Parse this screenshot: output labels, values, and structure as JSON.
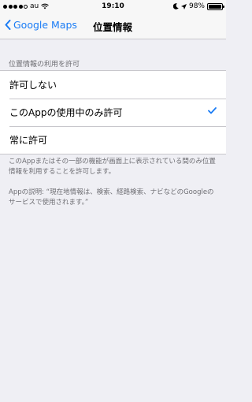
{
  "status_bar": {
    "carrier": "au",
    "time": "19:10",
    "battery_percent": "98%",
    "battery_level": 0.98,
    "icons": [
      "signal-dots-icon",
      "wifi-icon",
      "moon-icon",
      "location-arrow-icon",
      "battery-icon"
    ]
  },
  "nav": {
    "back_label": "Google Maps",
    "title": "位置情報"
  },
  "section": {
    "header": "位置情報の利用を許可"
  },
  "options": [
    {
      "label": "許可しない",
      "selected": false
    },
    {
      "label": "このAppの使用中のみ許可",
      "selected": true
    },
    {
      "label": "常に許可",
      "selected": false
    }
  ],
  "footer": {
    "note1": "このAppまたはその一部の機能が画面上に表示されている間のみ位置情報を利用することを許可します。",
    "note2": "Appの説明: “現在地情報は、検索、経路検索、ナビなどのGoogleのサービスで使用されます。”"
  },
  "colors": {
    "accent": "#1a7cf5",
    "background": "#efeff4",
    "separator": "#c8c7cc",
    "secondary_text": "#6d6d72"
  }
}
